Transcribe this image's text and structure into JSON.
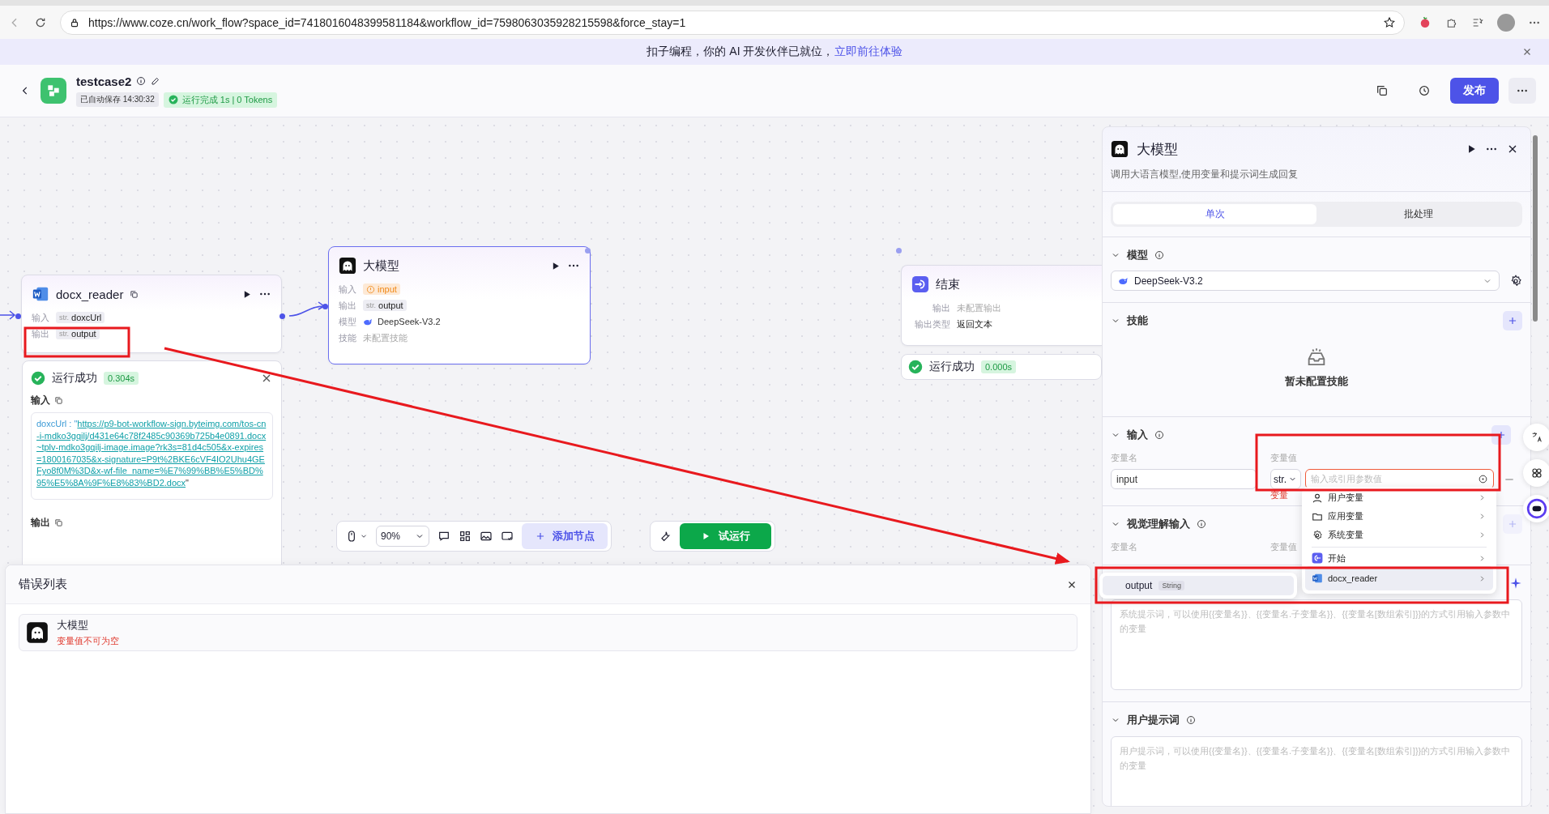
{
  "browser": {
    "url": "https://www.coze.cn/work_flow?space_id=7418016048399581184&workflow_id=7598063035928215598&force_stay=1"
  },
  "banner": {
    "text": "扣子编程，你的 AI 开发伙伴已就位，",
    "link": "立即前往体验"
  },
  "header": {
    "title": "testcase2",
    "autosave": "已自动保存 14:30:32",
    "run_status": "运行完成 1s | 0 Tokens",
    "publish": "发布"
  },
  "nodes": [
    {
      "kind": "docx",
      "title": "docx_reader",
      "selected": false,
      "rows": [
        {
          "kind": "var",
          "label": "输入",
          "type": "str.",
          "value": "doxcUrl"
        },
        {
          "kind": "var",
          "label": "输出",
          "type": "str.",
          "value": "output"
        }
      ]
    },
    {
      "kind": "llm",
      "title": "大模型",
      "selected": true,
      "rows": [
        {
          "kind": "warning",
          "label": "输入",
          "value": "input"
        },
        {
          "kind": "var",
          "label": "输出",
          "type": "str.",
          "value": "output"
        },
        {
          "kind": "model",
          "label": "模型",
          "value": "DeepSeek-V3.2"
        },
        {
          "kind": "empty",
          "label": "技能",
          "value": "未配置技能"
        }
      ]
    },
    {
      "kind": "end",
      "title": "结束",
      "selected": false,
      "rows": [
        {
          "kind": "empty",
          "label": "输出",
          "value": "未配置输出"
        },
        {
          "kind": "text",
          "label": "输出类型",
          "value": "返回文本"
        }
      ],
      "result": {
        "status": "运行成功",
        "time": "0.000s"
      }
    }
  ],
  "run_result": {
    "status": "运行成功",
    "time": "0.304s",
    "input_label": "输入",
    "key": "doxcUrl : \"",
    "link": "https://p9-bot-workflow-sign.byteimg.com/tos-cn-i-mdko3gqilj/d431e64c78f2485c90369b725b4e0891.docx~tplv-mdko3gqilj-image.image?rk3s=81d4c505&x-expires=1800167035&x-signature=P9t%2BKE6cVF4IO2Uhu4GEFyo8f0M%3D&x-wf-file_name=%E7%99%BB%E5%BD%95%E5%8A%9F%E8%83%BD2.docx",
    "close_quote": "\"",
    "output_label": "输出"
  },
  "toolbar": {
    "zoom": "90%",
    "add_node": "添加节点",
    "test_run": "试运行"
  },
  "error_list": {
    "title": "错误列表",
    "items": [
      {
        "node": "大模型",
        "message": "变量值不可为空"
      }
    ]
  },
  "panel": {
    "title": "大模型",
    "description": "调用大语言模型,使用变量和提示词生成回复",
    "tabs": [
      {
        "label": "单次",
        "selected": true
      },
      {
        "label": "批处理",
        "selected": false
      }
    ],
    "model": {
      "title": "模型",
      "value": "DeepSeek-V3.2"
    },
    "skills": {
      "title": "技能",
      "empty": "暂未配置技能"
    },
    "input": {
      "title": "输入",
      "name_label": "变量名",
      "value_label": "变量值",
      "name": "input",
      "type": "str.",
      "placeholder": "输入或引用参数值",
      "error": "变量"
    },
    "vision": {
      "title": "视觉理解输入",
      "name_label": "变量名",
      "value_label": "变量值"
    },
    "system_prompt": {
      "placeholder": "系统提示词，可以使用{{变量名}}、{{变量名.子变量名}}、{{变量名[数组索引]}}的方式引用输入参数中的变量"
    },
    "user_prompt": {
      "title": "用户提示词",
      "placeholder": "用户提示词，可以使用{{变量名}}、{{变量名.子变量名}}、{{变量名[数组索引]}}的方式引用输入参数中的变量"
    }
  },
  "dropdown": {
    "items": [
      {
        "kind": "user",
        "label": "用户变量",
        "selected": false
      },
      {
        "kind": "app",
        "label": "应用变量",
        "selected": false
      },
      {
        "kind": "system",
        "label": "系统变量",
        "selected": false
      },
      {
        "kind": "start",
        "label": "开始",
        "selected": false
      },
      {
        "kind": "docx",
        "label": "docx_reader",
        "selected": true
      }
    ],
    "submenu": {
      "name": "output",
      "type": "String"
    }
  },
  "annotations": [
    {
      "kind": "box"
    },
    {
      "kind": "box"
    },
    {
      "kind": "box"
    },
    {
      "kind": "arrow"
    }
  ]
}
